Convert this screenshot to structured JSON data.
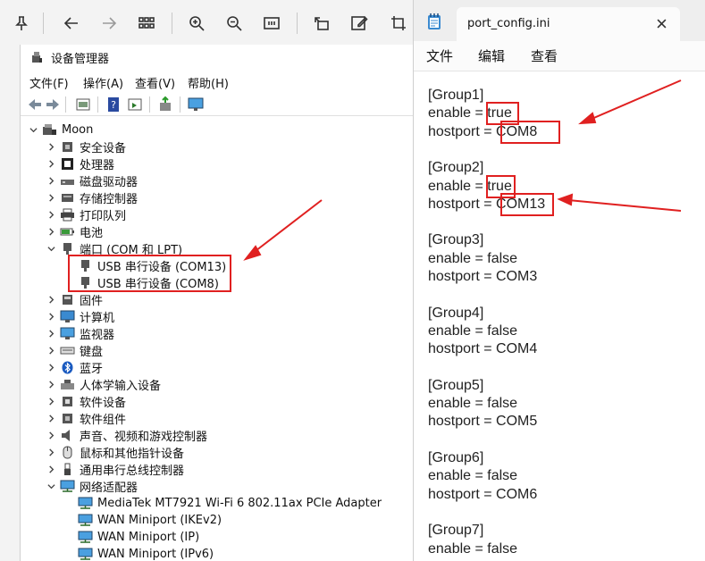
{
  "colors": {
    "annotation": "#e02020",
    "accent": "#0067c0"
  },
  "viewer_toolbar": {
    "icons": [
      "pin-icon",
      "back-arrow-icon",
      "forward-arrow-icon",
      "grid-icon",
      "zoom-in-icon",
      "zoom-out-icon",
      "fit-icon",
      "rotate-icon",
      "edit-icon",
      "crop-icon"
    ]
  },
  "device_manager": {
    "title": "设备管理器",
    "menu": [
      "文件(F)",
      "操作(A)",
      "查看(V)",
      "帮助(H)"
    ],
    "root": "Moon",
    "items": [
      {
        "label": "安全设备",
        "icon": "security-device-icon"
      },
      {
        "label": "处理器",
        "icon": "processor-icon"
      },
      {
        "label": "磁盘驱动器",
        "icon": "disk-drive-icon"
      },
      {
        "label": "存储控制器",
        "icon": "storage-controller-icon"
      },
      {
        "label": "打印队列",
        "icon": "printer-icon"
      },
      {
        "label": "电池",
        "icon": "battery-icon"
      },
      {
        "label": "端口 (COM 和 LPT)",
        "icon": "port-icon"
      },
      {
        "label": "USB 串行设备 (COM13)",
        "icon": "port-icon"
      },
      {
        "label": "USB 串行设备 (COM8)",
        "icon": "port-icon"
      },
      {
        "label": "固件",
        "icon": "firmware-icon"
      },
      {
        "label": "计算机",
        "icon": "computer-icon"
      },
      {
        "label": "监视器",
        "icon": "monitor-icon"
      },
      {
        "label": "键盘",
        "icon": "keyboard-icon"
      },
      {
        "label": "蓝牙",
        "icon": "bluetooth-icon"
      },
      {
        "label": "人体学输入设备",
        "icon": "hid-icon"
      },
      {
        "label": "软件设备",
        "icon": "software-device-icon"
      },
      {
        "label": "软件组件",
        "icon": "software-component-icon"
      },
      {
        "label": "声音、视频和游戏控制器",
        "icon": "sound-icon"
      },
      {
        "label": "鼠标和其他指针设备",
        "icon": "mouse-icon"
      },
      {
        "label": "通用串行总线控制器",
        "icon": "usb-icon"
      },
      {
        "label": "网络适配器",
        "icon": "network-adapter-icon"
      },
      {
        "label": "MediaTek MT7921 Wi-Fi 6 802.11ax PCIe Adapter",
        "icon": "network-adapter-icon"
      },
      {
        "label": "WAN Miniport (IKEv2)",
        "icon": "network-adapter-icon"
      },
      {
        "label": "WAN Miniport (IP)",
        "icon": "network-adapter-icon"
      },
      {
        "label": "WAN Miniport (IPv6)",
        "icon": "network-adapter-icon"
      }
    ]
  },
  "notepad": {
    "tab_title": "port_config.ini",
    "menu": [
      "文件",
      "编辑",
      "查看"
    ],
    "lines": [
      "[Group1]",
      "enable = true",
      "hostport = COM8",
      "",
      "[Group2]",
      "enable = true",
      "hostport = COM13",
      "",
      "[Group3]",
      "enable = false",
      "hostport = COM3",
      "",
      "[Group4]",
      "enable = false",
      "hostport = COM4",
      "",
      "[Group5]",
      "enable = false",
      "hostport = COM5",
      "",
      "[Group6]",
      "enable = false",
      "hostport = COM6",
      "",
      "[Group7]",
      "enable = false"
    ]
  }
}
